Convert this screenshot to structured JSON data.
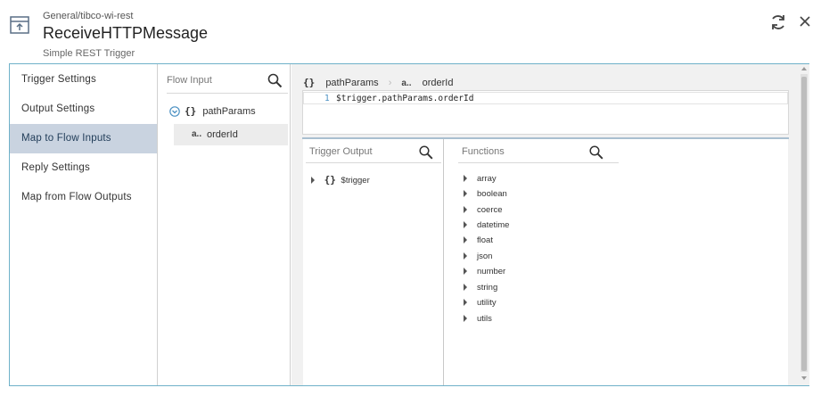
{
  "header": {
    "path": "General/tibco-wi-rest",
    "title": "ReceiveHTTPMessage",
    "subtitle": "Simple REST Trigger",
    "icon": "trigger-icon"
  },
  "nav": {
    "items": [
      {
        "label": "Trigger Settings"
      },
      {
        "label": "Output Settings"
      },
      {
        "label": "Map to Flow Inputs",
        "active": true
      },
      {
        "label": "Reply Settings"
      },
      {
        "label": "Map from Flow Outputs"
      }
    ]
  },
  "flow_input": {
    "header": "Flow Input",
    "tree": {
      "node": {
        "icon": "{}",
        "label": "pathParams"
      },
      "child": {
        "icon": "a..",
        "label": "orderId"
      }
    }
  },
  "mapping": {
    "breadcrumb": {
      "first_icon": "{}",
      "first": "pathParams",
      "sep": "›",
      "second_icon": "a..",
      "second": "orderId"
    },
    "editor": {
      "line_number": "1",
      "code": "$trigger.pathParams.orderId"
    }
  },
  "trigger_output": {
    "header": "Trigger Output",
    "node": {
      "icon": "{}",
      "label": "$trigger"
    }
  },
  "functions": {
    "header": "Functions",
    "items": [
      "array",
      "boolean",
      "coerce",
      "datetime",
      "float",
      "json",
      "number",
      "string",
      "utility",
      "utils"
    ]
  },
  "colors": {
    "accent_border": "#6fb1c9",
    "active_nav": "#c9d3e0",
    "line_number": "#4a90c2"
  }
}
